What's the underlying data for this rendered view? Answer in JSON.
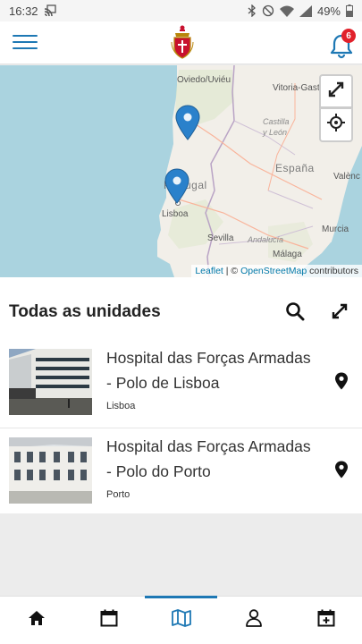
{
  "status_bar": {
    "time": "16:32",
    "battery": "49%"
  },
  "header": {
    "notification_count": "6",
    "icons": [
      "menu-icon",
      "crest-logo",
      "bell-icon"
    ]
  },
  "map": {
    "labels": {
      "oviedo": "Oviedo/Uviéu",
      "vitoria": "Vitoria-Gast",
      "castilla": "Castilla",
      "leon": "y León",
      "portugal": "Portugal",
      "espana": "España",
      "valencia": "Valènc",
      "lisboa": "Lisboa",
      "sevilla": "Sevilla",
      "andalucia": "Andalucía",
      "murcia": "Murcia",
      "malaga": "Málaga"
    },
    "attribution": {
      "leaflet": "Leaflet",
      "sep": " | © ",
      "osm": "OpenStreetMap",
      "contributors": " contributors"
    },
    "colors": {
      "sea": "#aad3df",
      "land": "#f2efe9",
      "marker": "#2a81cb"
    }
  },
  "section": {
    "title": "Todas as unidades"
  },
  "units": [
    {
      "name": "Hospital das Forças Armadas - Polo de Lisboa",
      "city": "Lisboa"
    },
    {
      "name": "Hospital das Forças Armadas - Polo do Porto",
      "city": "Porto"
    }
  ],
  "bottom_nav": {
    "items": [
      "home-icon",
      "calendar-icon",
      "map-icon",
      "profile-icon",
      "calendar-add-icon"
    ],
    "active": "map-icon",
    "accent": "#1e78b4"
  }
}
